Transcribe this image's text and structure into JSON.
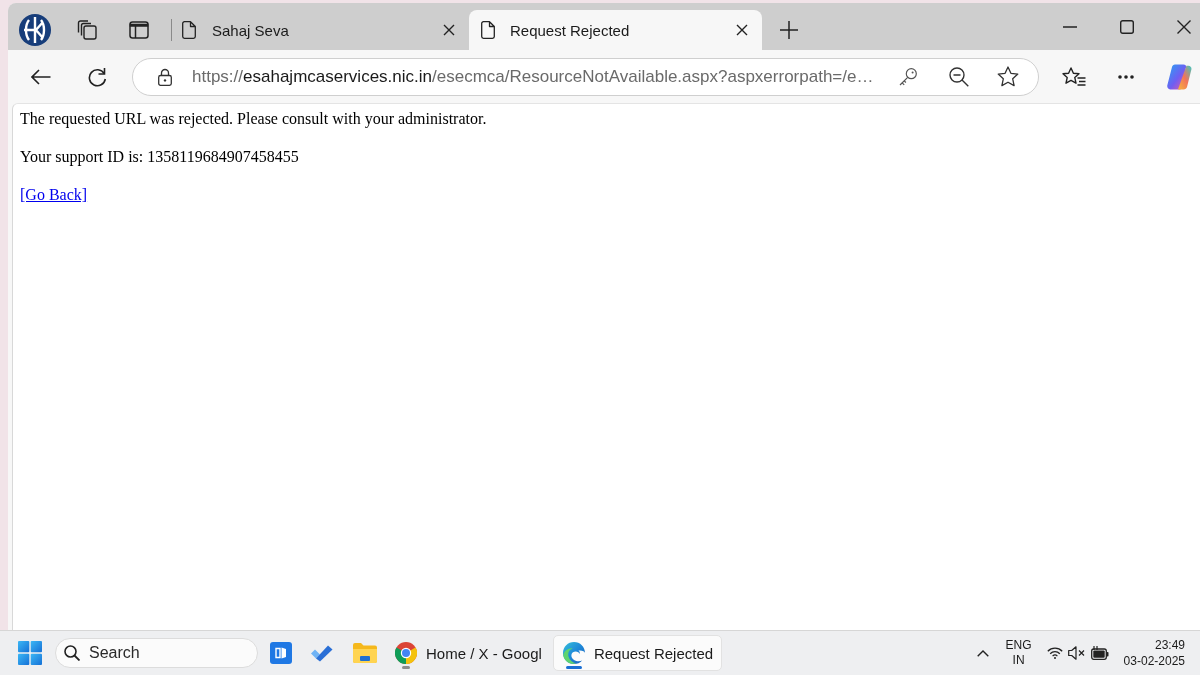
{
  "window": {
    "tabs": [
      {
        "title": "Sahaj Seva",
        "selected": false
      },
      {
        "title": "Request Rejected",
        "selected": true
      }
    ]
  },
  "address_bar": {
    "scheme": "https://",
    "host": "esahajmcaservices.nic.in",
    "path": "/esecmca/ResourceNotAvailable.aspx?aspxerrorpath=/e…"
  },
  "page": {
    "message": "The requested URL was rejected. Please consult with your administrator.",
    "support_id": "Your support ID is: 1358119684907458455",
    "link": "[Go Back]"
  },
  "taskbar": {
    "search": {
      "placeholder": "Search"
    },
    "windows": [
      {
        "label": "Home / X - Googl",
        "selected": false
      },
      {
        "label": "Request Rejected",
        "selected": true
      }
    ],
    "tray": {
      "language": "ENG",
      "region": "IN",
      "time": "23:49",
      "date": "03-02-2025"
    }
  }
}
